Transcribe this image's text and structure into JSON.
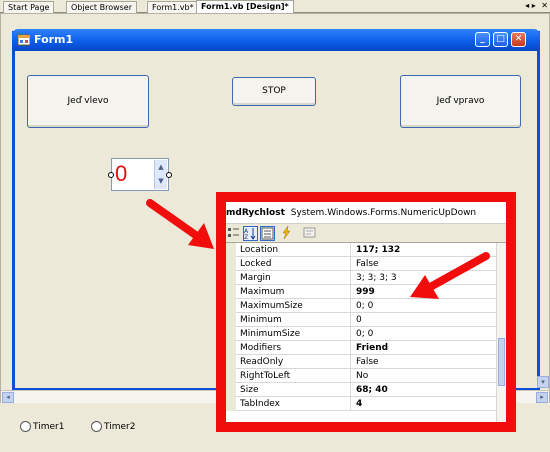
{
  "tabs": [
    {
      "label": "Start Page"
    },
    {
      "label": "Object Browser"
    },
    {
      "label": "Form1.vb*"
    },
    {
      "label": "Form1.vb [Design]*"
    }
  ],
  "tab_controls": {
    "scroll_label": "◂ ▸",
    "close_label": "✕"
  },
  "form": {
    "title": "Form1",
    "minimize": "_",
    "maximize": "□",
    "close": "✕",
    "buttons": {
      "left": "Jeď vlevo",
      "stop": "STOP",
      "right": "Jeď vpravo"
    },
    "numeric": {
      "value": "0",
      "up": "▲",
      "down": "▼"
    }
  },
  "scroll": {
    "left": "◂",
    "right": "▸",
    "down": "▾"
  },
  "tray": {
    "timer1": "Timer1",
    "timer2": "Timer2"
  },
  "properties": {
    "object_name": "mdRychlost",
    "object_type": "System.Windows.Forms.NumericUpDown",
    "rows": [
      {
        "name": "Location",
        "value": "117; 132",
        "bold": true
      },
      {
        "name": "Locked",
        "value": "False",
        "bold": false
      },
      {
        "name": "Margin",
        "value": "3; 3; 3; 3",
        "bold": false
      },
      {
        "name": "Maximum",
        "value": "999",
        "bold": true
      },
      {
        "name": "MaximumSize",
        "value": "0; 0",
        "bold": false
      },
      {
        "name": "Minimum",
        "value": "0",
        "bold": false
      },
      {
        "name": "MinimumSize",
        "value": "0; 0",
        "bold": false
      },
      {
        "name": "Modifiers",
        "value": "Friend",
        "bold": true
      },
      {
        "name": "ReadOnly",
        "value": "False",
        "bold": false
      },
      {
        "name": "RightToLeft",
        "value": "No",
        "bold": false
      },
      {
        "name": "Size",
        "value": "68; 40",
        "bold": true
      },
      {
        "name": "TabIndex",
        "value": "4",
        "bold": true
      }
    ]
  },
  "colors": {
    "highlight_frame": "#f20d0d",
    "titlebar": "#0a5be6",
    "numeric_text": "#e01010"
  }
}
